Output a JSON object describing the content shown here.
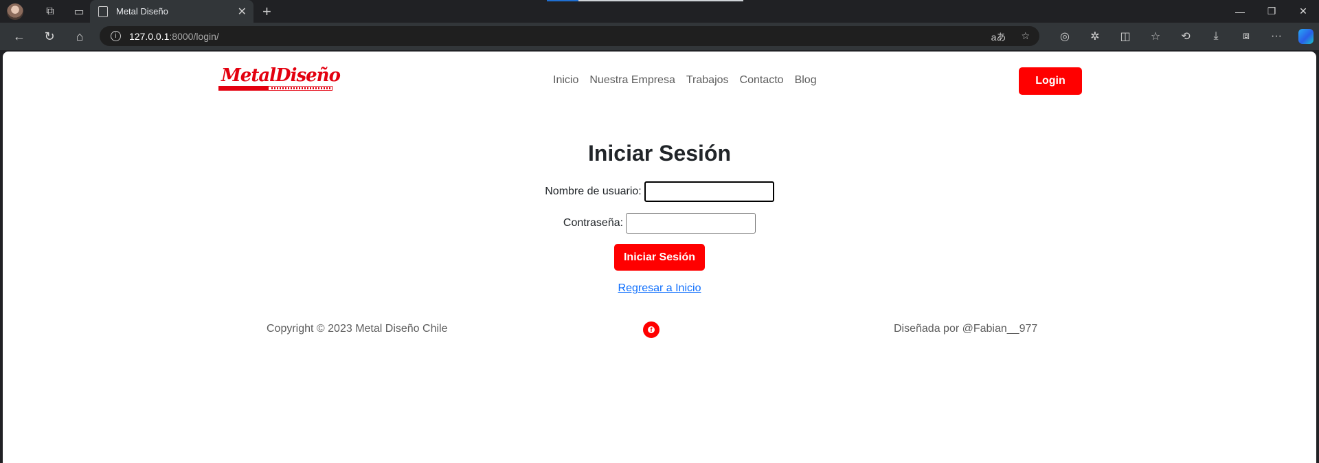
{
  "browser": {
    "tab_title": "Metal Diseño",
    "url_host": "127.0.0.1",
    "url_path": ":8000/login/"
  },
  "nav": {
    "logo_text": "MetalDiseño",
    "items": [
      "Inicio",
      "Nuestra Empresa",
      "Trabajos",
      "Contacto",
      "Blog"
    ],
    "login_label": "Login"
  },
  "login_form": {
    "title": "Iniciar Sesión",
    "username_label": "Nombre de usuario:",
    "username_value": "",
    "password_label": "Contraseña:",
    "password_value": "",
    "submit_label": "Iniciar Sesión",
    "back_link": "Regresar a Inicio"
  },
  "footer": {
    "copyright": "Copyright © 2023 Metal Diseño Chile",
    "social_icon": "facebook-icon",
    "credit": "Diseñada por @Fabian__977"
  },
  "colors": {
    "brand": "#ff0000",
    "link": "#0d6efd",
    "nav_text": "#5c5c5c"
  }
}
